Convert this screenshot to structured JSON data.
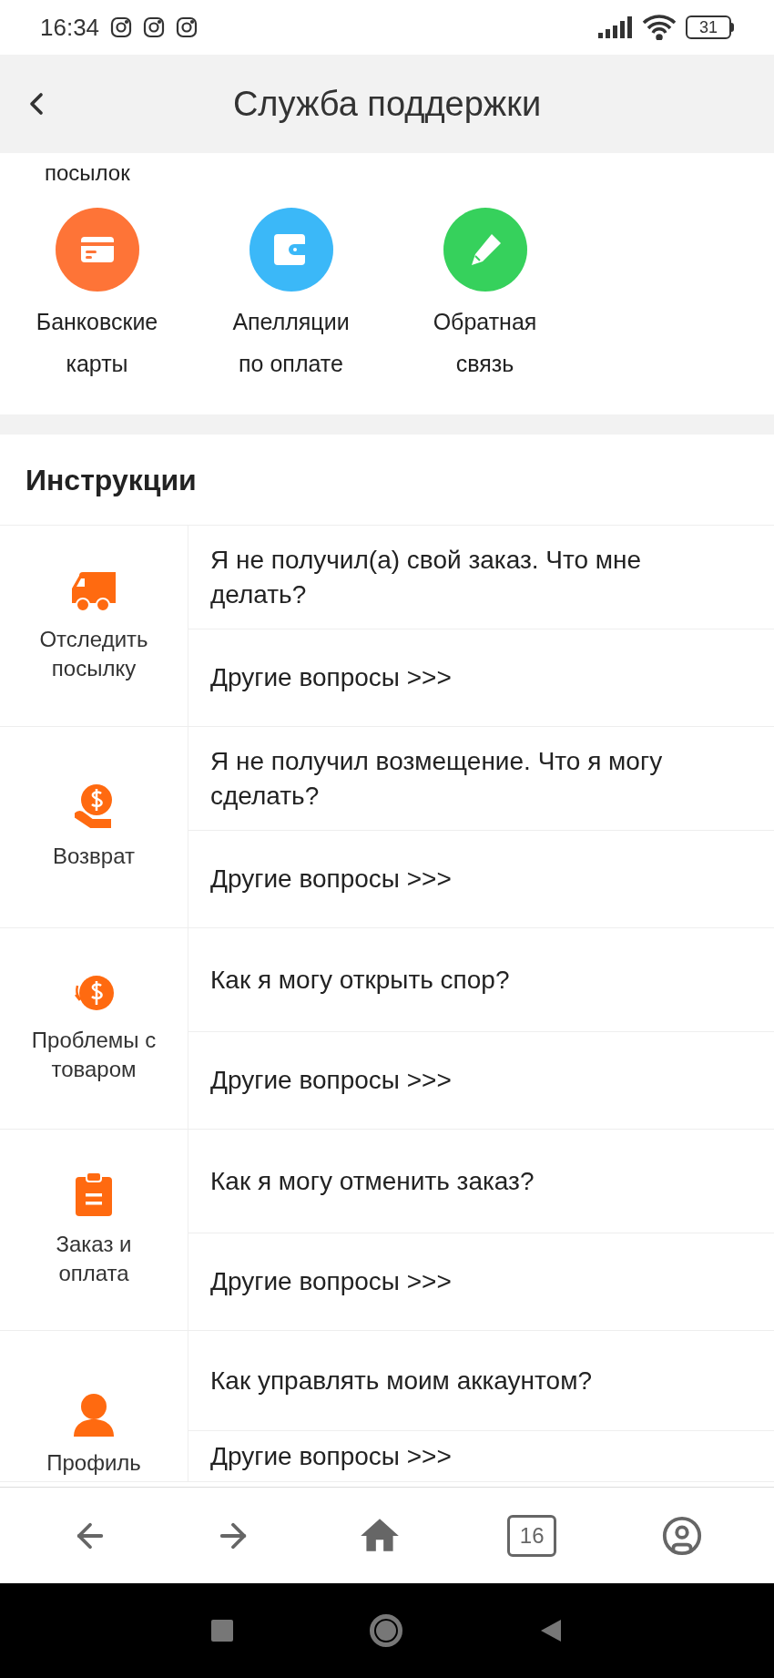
{
  "status_bar": {
    "time": "16:34",
    "battery": "31"
  },
  "header": {
    "title": "Служба поддержки"
  },
  "shortcuts": {
    "partial_label": "посылок",
    "items": [
      {
        "label": "Банковские\nкарты",
        "kind": "card",
        "color": "#fe7437"
      },
      {
        "label": "Апелляции\nпо оплате",
        "kind": "wallet",
        "color": "#3bb8f8"
      },
      {
        "label": "Обратная\nсвязь",
        "kind": "pencil",
        "color": "#36d15c"
      }
    ]
  },
  "instructions": {
    "title": "Инструкции",
    "categories": [
      {
        "label": "Отследить\nпосылку",
        "kind": "truck",
        "question": "Я не получил(а) свой заказ. Что мне делать?",
        "more": "Другие вопросы >>>"
      },
      {
        "label": "Возврат",
        "kind": "refund",
        "question": "Я не получил возмещение. Что я могу сделать?",
        "more": "Другие вопросы >>>"
      },
      {
        "label": "Проблемы с\nтоваром",
        "kind": "dispute",
        "question": "Как я могу открыть спор?",
        "more": "Другие вопросы >>>"
      },
      {
        "label": "Заказ и\nоплата",
        "kind": "clipboard",
        "question": "Как я могу отменить заказ?",
        "more": "Другие вопросы >>>"
      },
      {
        "label": "Профиль",
        "kind": "profile",
        "question": "Как управлять моим аккаунтом?",
        "more": "Другие вопросы >>>"
      }
    ]
  },
  "bottom_nav": {
    "tabs_count": "16"
  }
}
